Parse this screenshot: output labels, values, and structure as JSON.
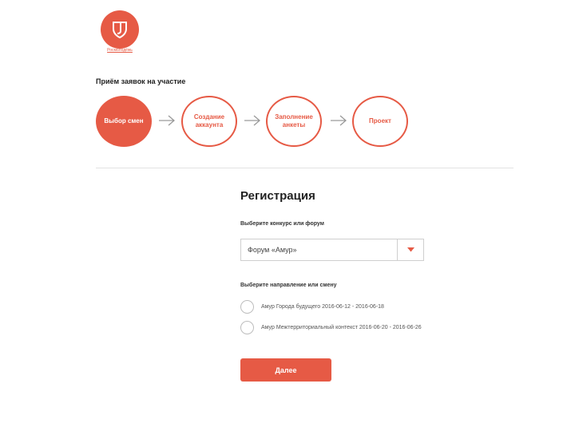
{
  "colors": {
    "accent": "#e65a45",
    "divider": "#e2e2e2",
    "border": "#cfcfcf"
  },
  "logo": {
    "icon": "shield-icon",
    "caption": "Росмолодёжь"
  },
  "process": {
    "title": "Приём заявок на участие",
    "steps": [
      {
        "label": "Выбор смен",
        "state": "active"
      },
      {
        "label": "Создание аккаунта",
        "state": "inactive"
      },
      {
        "label": "Заполнение анкеты",
        "state": "inactive"
      },
      {
        "label": "Проект",
        "state": "inactive"
      }
    ],
    "arrow_icon": "arrow-right-icon"
  },
  "form": {
    "title": "Регистрация",
    "contest_label": "Выберите конкурс или форум",
    "contest_value": "Форум «Амур»",
    "dropdown_icon": "caret-down-icon",
    "direction_label": "Выберите направление или смену",
    "options": [
      {
        "label": "Амур Города будущего 2016-06-12 - 2016-06-18",
        "selected": false
      },
      {
        "label": "Амур Межтерриториальный контекст 2016-06-20 - 2016-06-26",
        "selected": false
      }
    ],
    "next_label": "Далее"
  }
}
